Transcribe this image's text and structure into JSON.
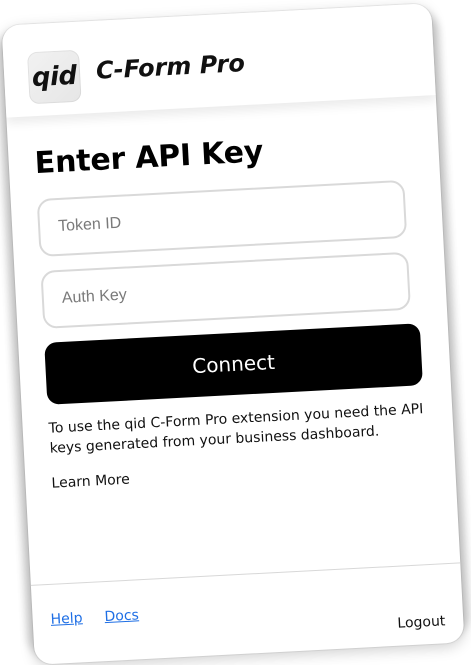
{
  "brand": {
    "logo_text": "qid",
    "app_name": "C-Form Pro"
  },
  "main": {
    "title": "Enter API Key",
    "token_field": {
      "placeholder": "Token ID",
      "value": ""
    },
    "auth_field": {
      "placeholder": "Auth Key",
      "value": ""
    },
    "connect_label": "Connect",
    "help_text": "To use the qid C-Form Pro extension you need the API keys generated from your business dashboard.",
    "learn_more_label": "Learn More"
  },
  "footer": {
    "links": [
      "Help",
      "Docs"
    ],
    "logout_label": "Logout"
  },
  "colors": {
    "accent_black": "#000000",
    "link_blue": "#1f6fe5",
    "border_gray": "#d9d9d9"
  }
}
